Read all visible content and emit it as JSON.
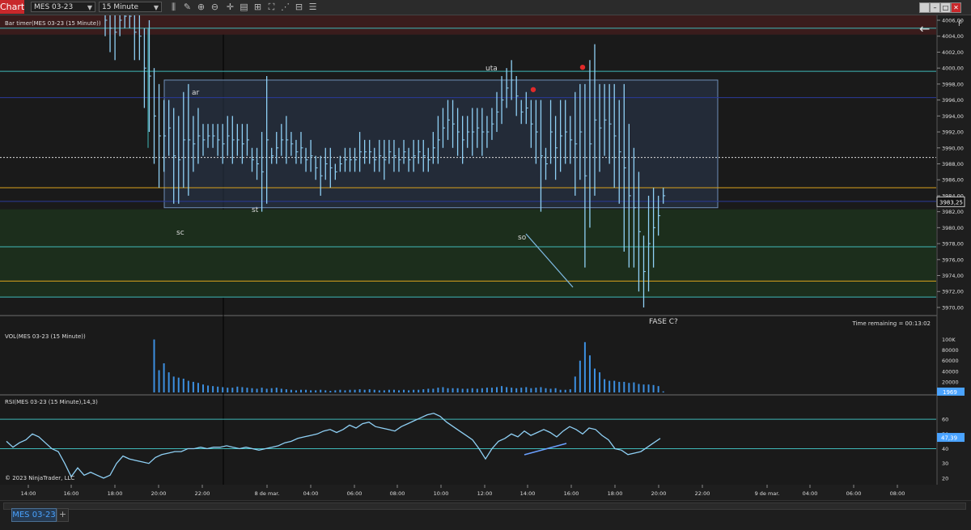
{
  "toolbar": {
    "chart_tab": "Chart",
    "instrument": "MES 03-23",
    "interval": "15 Minute"
  },
  "panels": {
    "price_title": "Bar timer(MES 03-23 (15 Minute))",
    "vol_title": "VOL(MES 03-23 (15 Minute))",
    "rsi_title": "RSI(MES 03-23 (15 Minute),14,3)",
    "time_remaining": "Time remaining = 00:13:02",
    "copyright": "© 2023 NinjaTrader, LLC",
    "f_button": "F",
    "back_arrow": "←"
  },
  "price_axis": {
    "ticks": [
      "4006,00",
      "4004,00",
      "4002,00",
      "4000,00",
      "3998,00",
      "3996,00",
      "3994,00",
      "3992,00",
      "3990,00",
      "3988,00",
      "3986,00",
      "3984,00",
      "3982,00",
      "3980,00",
      "3978,00",
      "3976,00",
      "3974,00",
      "3972,00",
      "3970,00"
    ],
    "current_price": "3983,25"
  },
  "vol_axis": {
    "ticks": [
      "100K",
      "80000",
      "60000",
      "40000",
      "20000"
    ],
    "current": "1969"
  },
  "rsi_axis": {
    "ticks": [
      "60",
      "50",
      "40",
      "30",
      "20"
    ],
    "current": "47,39"
  },
  "time_axis": [
    "14:00",
    "16:00",
    "18:00",
    "20:00",
    "22:00",
    "8 de mar.",
    "04:00",
    "06:00",
    "08:00",
    "10:00",
    "12:00",
    "14:00",
    "16:00",
    "18:00",
    "20:00",
    "22:00",
    "9 de mar.",
    "04:00",
    "06:00",
    "08:00"
  ],
  "annotations": [
    "ar",
    "sc",
    "st",
    "uta",
    "so",
    "FASE C?"
  ],
  "bottom": {
    "tab": "MES 03-23",
    "add": "+"
  },
  "colors": {
    "bars": "#8fd0f5",
    "zone_red": "#3a1c1c",
    "zone_green": "#1c2e1c",
    "box_fill": "#2b3b52",
    "cyan_line": "#3fb8b8",
    "orange_line": "#d9a21c",
    "blue_line": "#2a3a9a",
    "accent": "#4aa3ff",
    "chart_tab": "#c8282b"
  },
  "chart_data": {
    "type": "ohlc",
    "interval": "15 Minute",
    "instrument": "MES 03-23",
    "price_range": [
      3969,
      4008
    ],
    "horizontal_levels": [
      {
        "price": 4005,
        "color": "#3fb8b8"
      },
      {
        "price": 3999.6,
        "color": "#3fb8b8"
      },
      {
        "price": 3996.3,
        "color": "#2a3a9a"
      },
      {
        "price": 3988.8,
        "color": "#dddddd"
      },
      {
        "price": 3985,
        "color": "#d9a21c"
      },
      {
        "price": 3983.3,
        "color": "#2a3a9a"
      },
      {
        "price": 3977.6,
        "color": "#3fb8b8"
      },
      {
        "price": 3973.3,
        "color": "#d9a21c"
      },
      {
        "price": 3971.3,
        "color": "#3fb8b8"
      }
    ],
    "zones": [
      {
        "from": 4004.2,
        "to": 4008,
        "color": "#3a1c1c"
      },
      {
        "from": 3971.3,
        "to": 3982.3,
        "color": "#1c2e1c"
      }
    ],
    "range_box": {
      "high": 3998.5,
      "low": 3982.5,
      "start": "19:30",
      "end": "05:00 (9 mar)"
    },
    "bar_ranges": [
      [
        4004,
        4008
      ],
      [
        4002,
        4008
      ],
      [
        4001,
        4008
      ],
      [
        4004,
        4008
      ],
      [
        4005,
        4008
      ],
      [
        4005,
        4008
      ],
      [
        4001,
        4008
      ],
      [
        4001,
        4007
      ],
      [
        3995,
        4005
      ],
      [
        3992,
        4006
      ],
      [
        3988,
        4000
      ],
      [
        3985,
        3998
      ],
      [
        3987,
        3996
      ],
      [
        3989,
        3996
      ],
      [
        3983,
        3995
      ],
      [
        3983,
        3994
      ],
      [
        3985,
        3997
      ],
      [
        3984,
        3998
      ],
      [
        3987,
        3994
      ],
      [
        3988,
        3995
      ],
      [
        3989,
        3993
      ],
      [
        3990,
        3993
      ],
      [
        3990,
        3993
      ],
      [
        3989,
        3993
      ],
      [
        3988,
        3993
      ],
      [
        3989,
        3994
      ],
      [
        3988,
        3994
      ],
      [
        3989,
        3993
      ],
      [
        3988,
        3993
      ],
      [
        3989,
        3993
      ],
      [
        3987,
        3990
      ],
      [
        3986,
        3990
      ],
      [
        3982,
        3992
      ],
      [
        3983,
        3999
      ],
      [
        3988,
        3990
      ],
      [
        3988,
        3992
      ],
      [
        3989,
        3993
      ],
      [
        3988,
        3994
      ],
      [
        3989,
        3992
      ],
      [
        3988,
        3991
      ],
      [
        3988,
        3992
      ],
      [
        3987,
        3990
      ],
      [
        3987,
        3991
      ],
      [
        3986,
        3989
      ],
      [
        3984,
        3989
      ],
      [
        3986,
        3990
      ],
      [
        3985,
        3990
      ],
      [
        3986,
        3988
      ],
      [
        3987,
        3989
      ],
      [
        3987,
        3990
      ],
      [
        3987,
        3990
      ],
      [
        3987,
        3990
      ],
      [
        3987,
        3992
      ],
      [
        3988,
        3991
      ],
      [
        3988,
        3991
      ],
      [
        3987,
        3990
      ],
      [
        3987,
        3991
      ],
      [
        3986,
        3991
      ],
      [
        3988,
        3991
      ],
      [
        3987,
        3991
      ],
      [
        3987,
        3990
      ],
      [
        3988,
        3991
      ],
      [
        3987,
        3990
      ],
      [
        3987,
        3991
      ],
      [
        3988,
        3991
      ],
      [
        3987,
        3991
      ],
      [
        3987,
        3990
      ],
      [
        3988,
        3992
      ],
      [
        3988,
        3994
      ],
      [
        3990,
        3995
      ],
      [
        3991,
        3996
      ],
      [
        3990,
        3996
      ],
      [
        3989,
        3995
      ],
      [
        3988,
        3994
      ],
      [
        3990,
        3994
      ],
      [
        3989,
        3995
      ],
      [
        3990,
        3995
      ],
      [
        3989,
        3995
      ],
      [
        3990,
        3994
      ],
      [
        3991,
        3995
      ],
      [
        3992,
        3997
      ],
      [
        3993,
        3999
      ],
      [
        3995,
        4000
      ],
      [
        3996,
        4001
      ],
      [
        3994,
        3999
      ],
      [
        3993,
        3996
      ],
      [
        3993,
        3997
      ],
      [
        3990,
        3996
      ],
      [
        3988,
        3996
      ],
      [
        3982,
        3996
      ],
      [
        3986,
        3990
      ],
      [
        3988,
        3996
      ],
      [
        3986,
        3994
      ],
      [
        3987,
        3996
      ],
      [
        3988,
        3996
      ],
      [
        3988,
        3994
      ],
      [
        3984,
        3997
      ],
      [
        3986,
        3998
      ],
      [
        3975,
        3998
      ],
      [
        3980,
        4001
      ],
      [
        3984,
        4003
      ],
      [
        3987,
        3998
      ],
      [
        3989,
        3998
      ],
      [
        3988,
        3998
      ],
      [
        3985,
        3998
      ],
      [
        3983,
        3996
      ],
      [
        3977,
        3998
      ],
      [
        3975,
        3993
      ],
      [
        3975,
        3990
      ],
      [
        3972,
        3987
      ],
      [
        3970,
        3979
      ],
      [
        3972,
        3984
      ],
      [
        3975,
        3985
      ],
      [
        3979,
        3984
      ],
      [
        3983,
        3985
      ]
    ],
    "markers": [
      {
        "label": "red-dot",
        "price": 3997.3
      },
      {
        "label": "red-dot",
        "price": 4000.1
      }
    ],
    "volume": {
      "unit": "contracts",
      "ylim": [
        0,
        110000
      ],
      "values": [
        0,
        0,
        0,
        0,
        0,
        0,
        0,
        0,
        0,
        0,
        100000,
        42000,
        55000,
        38000,
        30000,
        28000,
        26000,
        22000,
        20000,
        18000,
        15000,
        13000,
        12000,
        11000,
        10000,
        9000,
        9000,
        11000,
        10000,
        9000,
        8000,
        7000,
        9000,
        7000,
        8000,
        9000,
        7000,
        6000,
        5000,
        4000,
        5000,
        5000,
        4000,
        4000,
        5000,
        4000,
        3000,
        4000,
        5000,
        4000,
        5000,
        5000,
        6000,
        5000,
        6000,
        5000,
        4000,
        4000,
        5000,
        5000,
        4000,
        5000,
        4000,
        5000,
        5000,
        6000,
        7000,
        7000,
        9000,
        10000,
        8000,
        8000,
        8000,
        7000,
        7000,
        8000,
        7000,
        8000,
        9000,
        9000,
        10000,
        12000,
        10000,
        9000,
        8000,
        9000,
        10000,
        8000,
        9000,
        10000,
        8000,
        7000,
        8000,
        5000,
        5000,
        6000,
        30000,
        60000,
        95000,
        70000,
        45000,
        38000,
        25000,
        22000,
        22000,
        20000,
        20000,
        18000,
        19000,
        16000,
        15000,
        15000,
        14000,
        12000,
        2000
      ]
    },
    "rsi": {
      "period": 14,
      "ylim": [
        15,
        65
      ],
      "levels": [
        40,
        60
      ],
      "values": [
        45,
        41,
        44,
        46,
        50,
        48,
        44,
        40,
        38,
        30,
        21,
        27,
        22,
        24,
        22,
        20,
        22,
        30,
        35,
        33,
        32,
        31,
        30,
        34,
        36,
        37,
        38,
        38,
        40,
        40,
        41,
        40,
        41,
        41,
        42,
        41,
        40,
        41,
        40,
        39,
        40,
        41,
        42,
        44,
        45,
        47,
        48,
        49,
        50,
        52,
        53,
        51,
        53,
        56,
        54,
        57,
        58,
        55,
        54,
        53,
        52,
        55,
        57,
        59,
        61,
        63,
        64,
        62,
        58,
        55,
        52,
        49,
        46,
        40,
        33,
        40,
        45,
        47,
        50,
        48,
        52,
        49,
        51,
        53,
        51,
        48,
        52,
        55,
        53,
        50,
        54,
        53,
        49,
        46,
        40,
        39,
        36,
        37,
        38,
        41,
        44,
        47
      ]
    }
  }
}
